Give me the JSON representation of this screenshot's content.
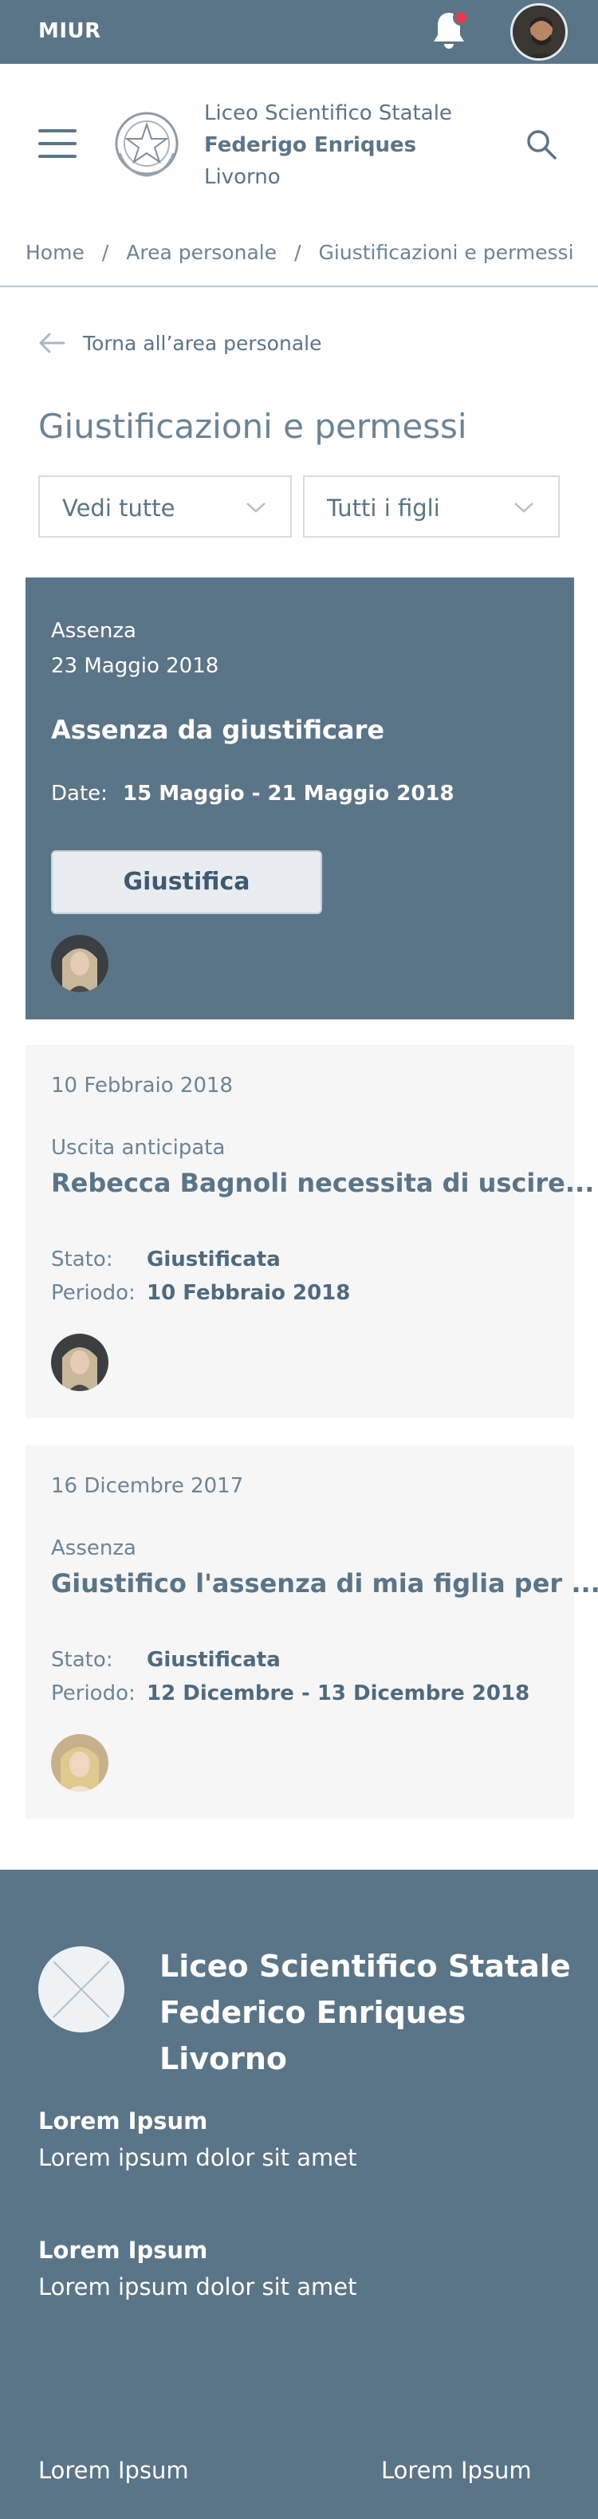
{
  "topbar": {
    "brand": "MIUR",
    "bell_icon": "bell-icon",
    "has_notification": true
  },
  "header": {
    "school_line1": "Liceo Scientifico Statale",
    "school_line2": "Federigo Enriques",
    "school_line3": "Livorno"
  },
  "breadcrumb": {
    "home": "Home",
    "area": "Area personale",
    "current": "Giustificazioni e permessi",
    "separator": "/"
  },
  "back": {
    "label": "Torna all’area personale"
  },
  "page": {
    "title": "Giustificazioni e permessi"
  },
  "filters": {
    "show": "Vedi tutte",
    "children": "Tutti i figli"
  },
  "cards": [
    {
      "kind": "Assenza",
      "date": "23 Maggio 2018",
      "title": "Assenza da giustificare",
      "date_label": "Date:",
      "date_value": "15 Maggio - 21 Maggio 2018",
      "action": "Giustifica"
    },
    {
      "date": "10 Febbraio 2018",
      "kind": "Uscita anticipata",
      "title": "Rebecca Bagnoli necessita di uscire...",
      "state_label": "Stato:",
      "state_value": "Giustificata",
      "period_label": "Periodo:",
      "period_value": "10 Febbraio 2018"
    },
    {
      "date": "16 Dicembre 2017",
      "kind": "Assenza",
      "title": "Giustifico l'assenza di mia figlia per ...",
      "state_label": "Stato:",
      "state_value": "Giustificata",
      "period_label": "Periodo:",
      "period_value": "12 Dicembre - 13 Dicembre 2018"
    }
  ],
  "footer": {
    "name_line1": "Liceo Scientifico Statale",
    "name_line2": "Federico Enriques",
    "name_line3": "Livorno",
    "block1_heading": "Lorem Ipsum",
    "block1_text": "Lorem ipsum dolor sit amet",
    "block2_heading": "Lorem Ipsum",
    "block2_text": "Lorem ipsum dolor sit amet",
    "link1": "Lorem Ipsum",
    "link2": "Lorem Ipsum"
  },
  "colors": {
    "primary": "#5a7488",
    "text": "#5c7386",
    "notification": "#e23a4f",
    "card_bg": "#f6f6f6"
  }
}
